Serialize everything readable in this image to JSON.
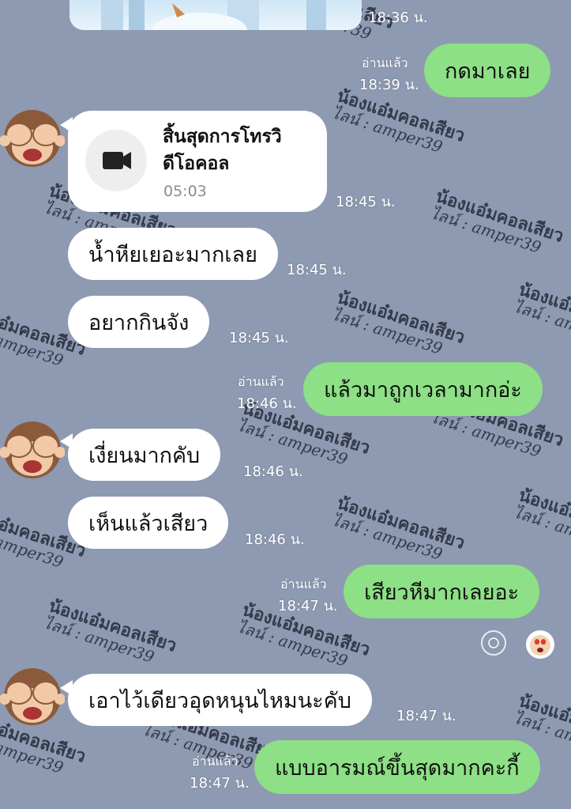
{
  "watermark": {
    "line1": "น้องแอ๋มคอลเสียว",
    "line2": "ไลน์ : amper39"
  },
  "top_time": "18:36 น.",
  "messages": [
    {
      "dir": "out",
      "text": "กดมาเลย",
      "read": "อ่านแล้ว",
      "time": "18:39 น."
    },
    {
      "dir": "in",
      "type": "call",
      "title": "สิ้นสุดการโทรวิดีโอคอล",
      "title_l1": "สิ้นสุดการโทรวิ",
      "title_l2": "ดีโอคอล",
      "duration": "05:03",
      "time": "18:45 น.",
      "icon": "video-camera-icon"
    },
    {
      "dir": "in",
      "text": "น้ำหียเยอะมากเลย",
      "time": "18:45 น."
    },
    {
      "dir": "in",
      "text": "อยากกินจัง",
      "time": "18:45 น."
    },
    {
      "dir": "out",
      "text": "แล้วมาถูกเวลามากอ่ะ",
      "read": "อ่านแล้ว",
      "time": "18:46 น."
    },
    {
      "dir": "in",
      "text": "เงี่ยนมากคับ",
      "time": "18:46 น."
    },
    {
      "dir": "in",
      "text": "เห็นแล้วเสียว",
      "time": "18:46 น."
    },
    {
      "dir": "out",
      "text": "เสียวหีมากเลยอะ",
      "read": "อ่านแล้ว",
      "time": "18:47 น.",
      "reaction": "heart-eyes-face-icon"
    },
    {
      "dir": "in",
      "text": "เอาไว้เดียวอุดหนุนไหมนะคับ",
      "time": "18:47 น."
    },
    {
      "dir": "out",
      "text": "แบบอารมณ์ขึ้นสุดมากคะกี้",
      "read": "อ่านแล้ว",
      "time": "18:47 น."
    }
  ],
  "colors": {
    "background": "#8d9ab1",
    "incoming": "#ffffff",
    "outgoing": "#8de085"
  },
  "avatar_icon": "monkey-covering-eyes-icon"
}
